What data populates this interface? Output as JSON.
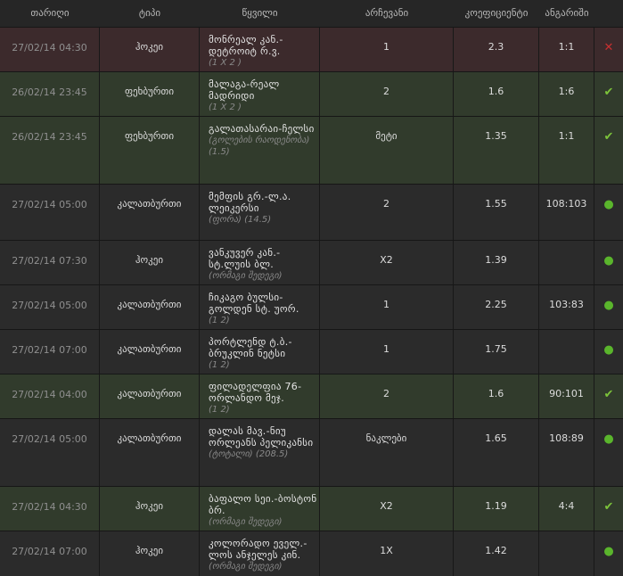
{
  "headers": [
    "თარიღი",
    "ტიპი",
    "წყვილი",
    "არჩევანი",
    "კოეფიციენტი",
    "ანგარიში",
    ""
  ],
  "rows": [
    {
      "state": "lost",
      "date": "27/02/14 04:30",
      "type": "ჰოკეი",
      "event": "მონრეალ კან.-დეტროიტ რ.ვ.",
      "sub": "(1 X 2 )",
      "choice": "1",
      "odds": "2.3",
      "score": "1:1",
      "icon": "x-icon",
      "bg": "#3c2a2c"
    },
    {
      "state": "won",
      "date": "26/02/14 23:45",
      "type": "ფეხბურთი",
      "event": "მალაგა-რეალ მადრიდი",
      "sub": "(1 X 2 )",
      "choice": "2",
      "odds": "1.6",
      "score": "1:6",
      "icon": "check-icon",
      "bg": "#313b2c"
    },
    {
      "state": "won",
      "date": "26/02/14 23:45",
      "type": "ფეხბურთი",
      "event": "გალათასარაი-ჩელსი",
      "sub": "(გოლების რაოდენობა) (1.5)",
      "choice": "მეტი",
      "odds": "1.35",
      "score": "1:1",
      "icon": "check-icon",
      "bg": "#313b2c"
    },
    {
      "state": "pending",
      "date": "27/02/14 05:00",
      "type": "კალათბურთი",
      "event": "მემფის გრ.-ლ.ა. ლეიკერსი",
      "sub": "(ფორა) (14.5)",
      "choice": "2",
      "odds": "1.55",
      "score": "108:103",
      "icon": "dot-icon",
      "bg": "#2b2b2b"
    },
    {
      "state": "pending",
      "date": "27/02/14 07:30",
      "type": "ჰოკეი",
      "event": "ვანკუვერ კან.-სტ.ლუის ბლ.",
      "sub": "(ორმაგი შედეგი)",
      "choice": "X2",
      "odds": "1.39",
      "score": "",
      "icon": "dot-icon",
      "bg": "#2b2b2b"
    },
    {
      "state": "pending",
      "date": "27/02/14 05:00",
      "type": "კალათბურთი",
      "event": "ჩიკაგო ბულსი-გოლდენ სტ. უორ.",
      "sub": "(1 2)",
      "choice": "1",
      "odds": "2.25",
      "score": "103:83",
      "icon": "dot-icon",
      "bg": "#2b2b2b"
    },
    {
      "state": "pending",
      "date": "27/02/14 07:00",
      "type": "კალათბურთი",
      "event": "პორტლენდ ტ.ბ.-ბრუკლინ ნეტსი",
      "sub": "(1 2)",
      "choice": "1",
      "odds": "1.75",
      "score": "",
      "icon": "dot-icon",
      "bg": "#2b2b2b"
    },
    {
      "state": "won",
      "date": "27/02/14 04:00",
      "type": "კალათბურთი",
      "event": "ფილადელფია 76-ორლანდო მეჯ.",
      "sub": "(1 2)",
      "choice": "2",
      "odds": "1.6",
      "score": "90:101",
      "icon": "check-icon",
      "bg": "#313b2c"
    },
    {
      "state": "pending",
      "date": "27/02/14 05:00",
      "type": "კალათბურთი",
      "event": "დალას მავ.-ნიუ ორლეანს პელიკანსი",
      "sub": "(ტოტალი) (208.5)",
      "choice": "ნაკლები",
      "odds": "1.65",
      "score": "108:89",
      "icon": "dot-icon",
      "bg": "#2b2b2b"
    },
    {
      "state": "won",
      "date": "27/02/14 04:30",
      "type": "ჰოკეი",
      "event": "ბაფალო სეი.-ბოსტონ ბრ.",
      "sub": "(ორმაგი შედეგი)",
      "choice": "X2",
      "odds": "1.19",
      "score": "4:4",
      "icon": "check-icon",
      "bg": "#313b2c"
    },
    {
      "state": "pending",
      "date": "27/02/14 07:00",
      "type": "ჰოკეი",
      "event": "კოლორადო ეველ.-ლოს ანჯელეს კინ.",
      "sub": "(ორმაგი შედეგი)",
      "choice": "1X",
      "odds": "1.42",
      "score": "",
      "icon": "dot-icon",
      "bg": "#2b2b2b"
    }
  ]
}
